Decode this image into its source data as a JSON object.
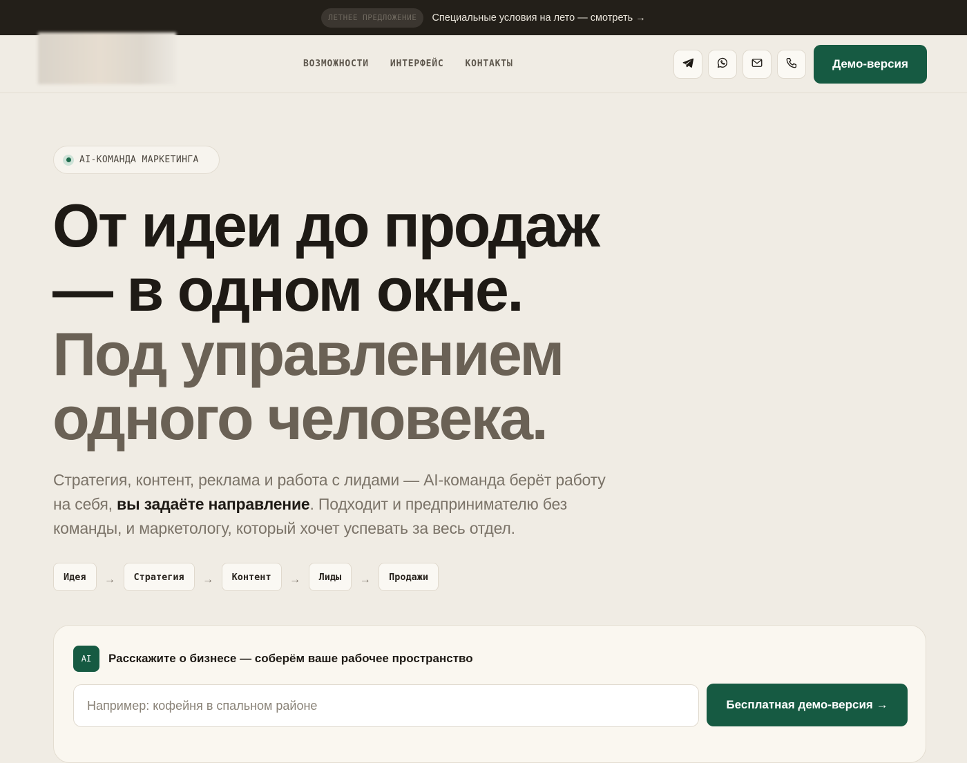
{
  "promo": {
    "badge": "Летнее предложение",
    "text": "Специальные условия на лето — смотреть →"
  },
  "header": {
    "nav": [
      "Возможности",
      "Интерфейс",
      "Контакты"
    ],
    "icons": [
      "telegram-icon",
      "whatsapp-icon",
      "mail-icon",
      "phone-icon"
    ],
    "demo_label": "Демо-версия"
  },
  "hero": {
    "pill": "AI-КОМАНДА МАРКЕТИНГА",
    "headline_dark_1": "От идеи до продаж",
    "headline_dark_2": "— в одном окне.",
    "headline_muted_1": "Под управлением",
    "headline_muted_2": "одного человека.",
    "lead_part1": "Стратегия, контент, реклама и работа с лидами — AI-команда берёт работу на себя, ",
    "lead_strong": "вы задаёте направление",
    "lead_part2": ". Подходит и предпринимателю без команды, и маркетологу, который хочет успевать за весь отдел.",
    "steps": [
      "Идея",
      "Стратегия",
      "Контент",
      "Лиды",
      "Продажи"
    ],
    "arrow": "→"
  },
  "card": {
    "badge": "AI",
    "title": "Расскажите о бизнесе — соберём ваше рабочее пространство",
    "input_placeholder": "Например: кофейня в спальном районе",
    "button_label": "Бесплатная демо-версия →"
  },
  "colors": {
    "accent": "#165a42",
    "promo_bg": "#231f19",
    "page_bg": "#f0ece4"
  }
}
